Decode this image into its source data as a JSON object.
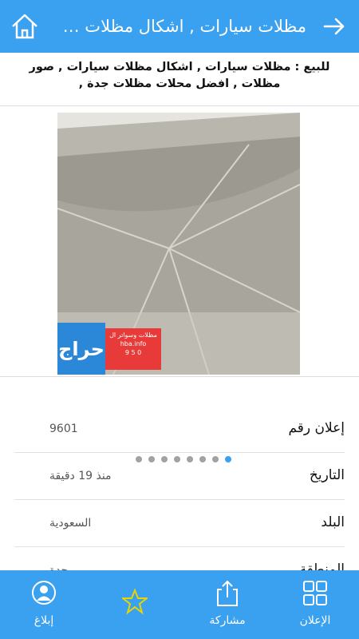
{
  "header": {
    "title": "مظلات سيارات , اشكال مظلات سيارات , صور مظلات",
    "home_icon": "home-icon",
    "back_icon": "arrow-right-icon"
  },
  "subtitle": "للبيع : مظلات سيارات , اشكال مظلات سيارات , صور مظلات , افضل محلات مظلات جدة ,",
  "gallery": {
    "logo_text": "حراج",
    "promo_lines": [
      "مظلات وسواتر ال",
      "hba.info",
      "9 5 0"
    ],
    "dots_count": 8,
    "active_dot": 7
  },
  "details": [
    {
      "label": "إعلان رقم",
      "value": "9601"
    },
    {
      "label": "التاريخ",
      "value": "منذ 19 دقيقة"
    },
    {
      "label": "البلد",
      "value": "السعودية"
    },
    {
      "label": "المنطقة",
      "value": "جدة"
    }
  ],
  "bottom_nav": {
    "ad": "الإعلان",
    "share": "مشاركة",
    "report": "إبلاغ"
  },
  "colors": {
    "primary": "#3aa0f0",
    "favorite_star": "#e8d400"
  }
}
